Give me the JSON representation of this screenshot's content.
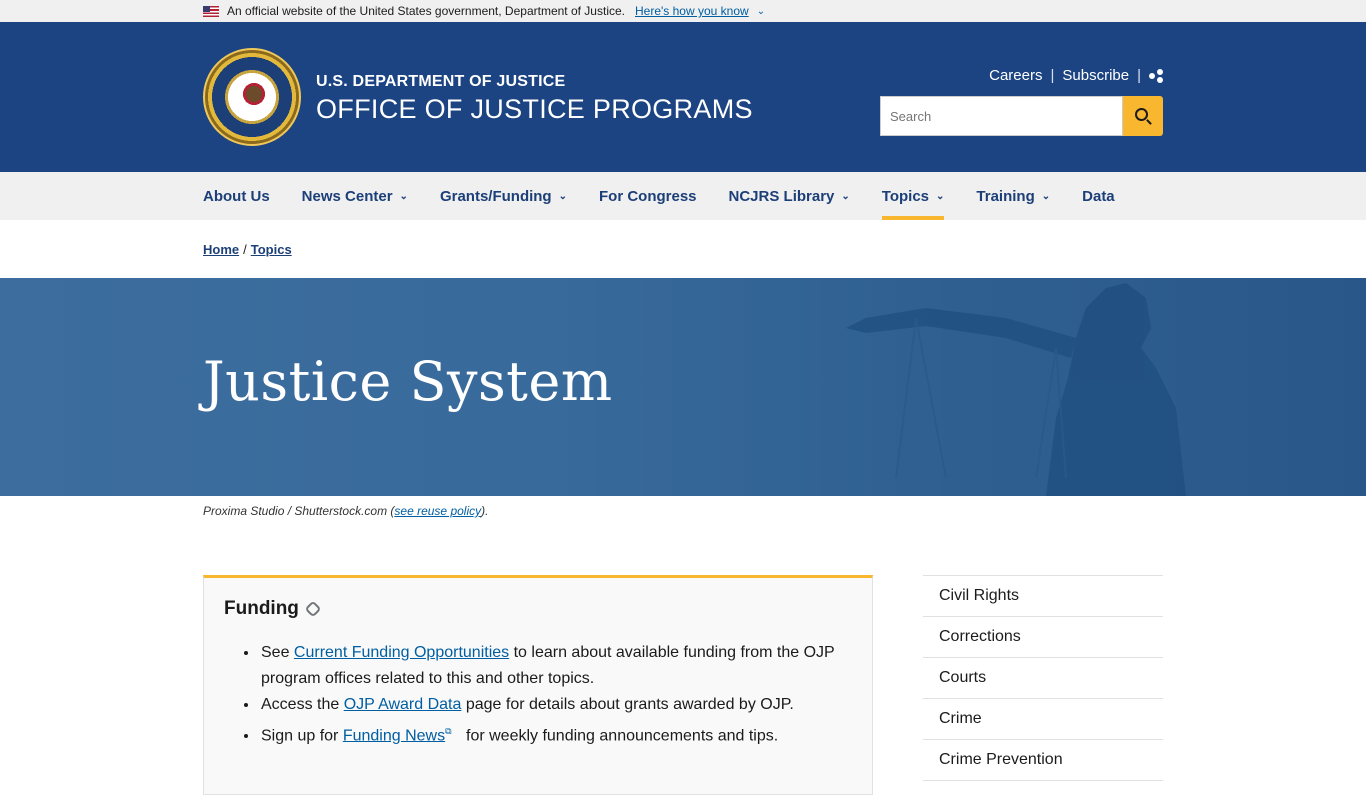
{
  "banner": {
    "text": "An official website of the United States government, Department of Justice.",
    "link": "Here's how you know"
  },
  "header": {
    "dept": "U.S. DEPARTMENT OF JUSTICE",
    "office": "OFFICE OF JUSTICE PROGRAMS",
    "careers": "Careers",
    "subscribe": "Subscribe",
    "sep": "|",
    "search_placeholder": "Search"
  },
  "nav": {
    "items": [
      {
        "label": "About Us"
      },
      {
        "label": "News Center"
      },
      {
        "label": "Grants/Funding"
      },
      {
        "label": "For Congress"
      },
      {
        "label": "NCJRS Library"
      },
      {
        "label": "Topics"
      },
      {
        "label": "Training"
      },
      {
        "label": "Data"
      }
    ],
    "active": "Topics"
  },
  "breadcrumb": {
    "home": "Home",
    "sep": "/",
    "topics": "Topics"
  },
  "hero": {
    "title": "Justice System",
    "credit_prefix": "Proxima Studio / Shutterstock.com (",
    "credit_link": "see reuse policy",
    "credit_suffix": ")."
  },
  "funding": {
    "heading": "Funding",
    "b1_pre": "See ",
    "b1_link": "Current Funding Opportunities",
    "b1_post": " to learn about available funding from the OJP program offices related to this and other topics.",
    "b2_pre": "Access the ",
    "b2_link": "OJP Award Data",
    "b2_post": " page for details about grants awarded by OJP.",
    "b3_pre": "Sign up for ",
    "b3_link": "Funding News",
    "b3_post": " for weekly funding announcements and tips."
  },
  "sidebar": {
    "items": [
      "Civil Rights",
      "Corrections",
      "Courts",
      "Crime",
      "Crime Prevention"
    ]
  },
  "colors": {
    "header_bg": "#1c4482",
    "accent": "#f9b72f",
    "link": "#005ea2"
  }
}
